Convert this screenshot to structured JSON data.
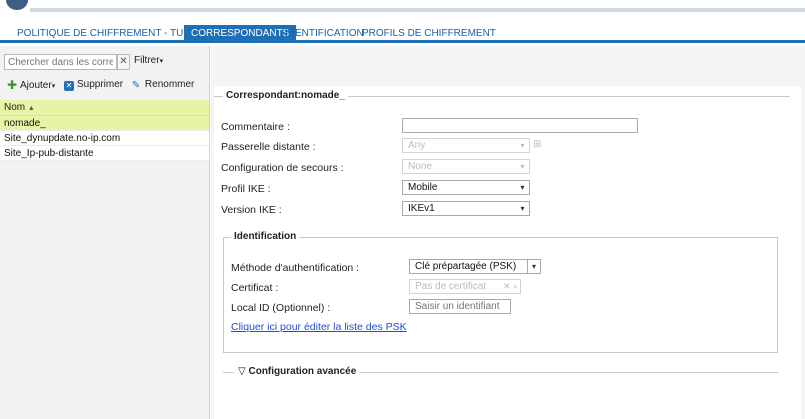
{
  "tabs": [
    {
      "label": "POLITIQUE DE CHIFFREMENT - TUNNELS",
      "active": false
    },
    {
      "label": "CORRESPONDANTS",
      "active": true
    },
    {
      "label": "IDENTIFICATION",
      "active": false
    },
    {
      "label": "PROFILS DE CHIFFREMENT",
      "active": false
    }
  ],
  "left": {
    "search_placeholder": "Chercher dans les corres",
    "search_clear": "✕",
    "filter_label": "Filtrer",
    "toolbar": {
      "add_label": "Ajouter",
      "delete_label": "Supprimer",
      "rename_label": "Renommer"
    },
    "list_header": "Nom",
    "items": [
      "nomade_",
      "Site_dynupdate.no-ip.com",
      "Site_Ip-pub-distante"
    ]
  },
  "form": {
    "legend": "Correspondant:nomade_",
    "commentaire_label": "Commentaire :",
    "commentaire_value": "",
    "passerelle_label": "Passerelle distante :",
    "passerelle_value": "Any",
    "secours_label": "Configuration de secours :",
    "secours_value": "None",
    "profil_label": "Profil IKE :",
    "profil_value": "Mobile",
    "version_label": "Version IKE :",
    "version_value": "IKEv1",
    "identification": {
      "legend": "Identification",
      "methode_label": "Méthode d'authentification :",
      "methode_value": "Clé prépartagée (PSK)",
      "certificat_label": "Certificat :",
      "certificat_placeholder": "Pas de certificat",
      "localid_label": "Local ID (Optionnel) :",
      "localid_placeholder": "Saisir un identifiant",
      "psk_link": "Cliquer ici pour éditer la liste des PSK"
    },
    "advanced_label": "Configuration avancée"
  },
  "colors": {
    "accent": "#1f6fb7",
    "selection": "#e6f4a6",
    "link": "#1f4fd0"
  }
}
